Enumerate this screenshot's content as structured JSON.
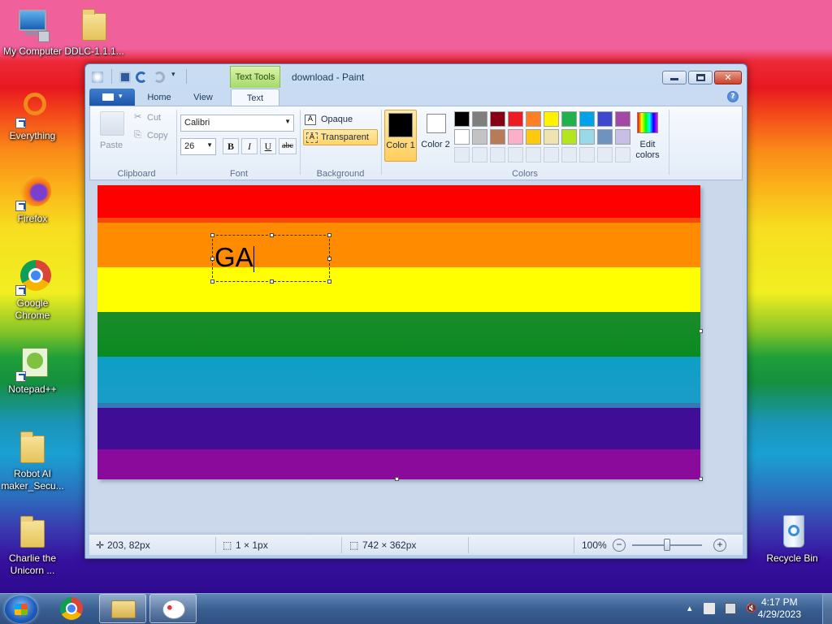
{
  "desktop": {
    "icons": [
      {
        "label": "My Computer"
      },
      {
        "label": "DDLC-1.1.1..."
      },
      {
        "label": "Everything"
      },
      {
        "label": "Firefox"
      },
      {
        "label": "Google Chrome"
      },
      {
        "label": "Notepad++"
      },
      {
        "label": "Robot AI maker_Secu..."
      },
      {
        "label": "Charlie the Unicorn ..."
      },
      {
        "label": "Recycle Bin"
      }
    ]
  },
  "window": {
    "title": "download - Paint",
    "contextual_tab": "Text Tools",
    "tabs": [
      {
        "label": "Home"
      },
      {
        "label": "View"
      },
      {
        "label": "Text"
      }
    ],
    "ribbon": {
      "clipboard": {
        "paste": "Paste",
        "cut": "Cut",
        "copy": "Copy",
        "group": "Clipboard"
      },
      "font": {
        "family": "Calibri",
        "size": "26",
        "bold": "B",
        "italic": "I",
        "underline": "U",
        "strike": "abc",
        "group": "Font"
      },
      "background": {
        "opaque": "Opaque",
        "transparent": "Transparent",
        "group": "Background"
      },
      "colors": {
        "color1": "Color 1",
        "color2": "Color 2",
        "edit": "Edit colors",
        "group": "Colors",
        "color1_value": "#000000",
        "color2_value": "#ffffff",
        "palette_row1": [
          "#000000",
          "#7f7f7f",
          "#880015",
          "#ed1c24",
          "#ff7f27",
          "#fff200",
          "#22b14c",
          "#00a2e8",
          "#3f48cc",
          "#a349a4"
        ],
        "palette_row2": [
          "#ffffff",
          "#c3c3c3",
          "#b97a57",
          "#ffaec9",
          "#ffc90e",
          "#efe4b0",
          "#b5e61d",
          "#99d9ea",
          "#7092be",
          "#c8bfe7"
        ]
      }
    },
    "canvas": {
      "text_content": "GA"
    },
    "statusbar": {
      "cursor_pos": "203, 82px",
      "selection_size": "1 × 1px",
      "image_size": "742 × 362px",
      "zoom": "100%",
      "zoom_level": 1.0
    }
  },
  "taskbar": {
    "time": "4:17 PM",
    "date": "4/29/2023"
  }
}
